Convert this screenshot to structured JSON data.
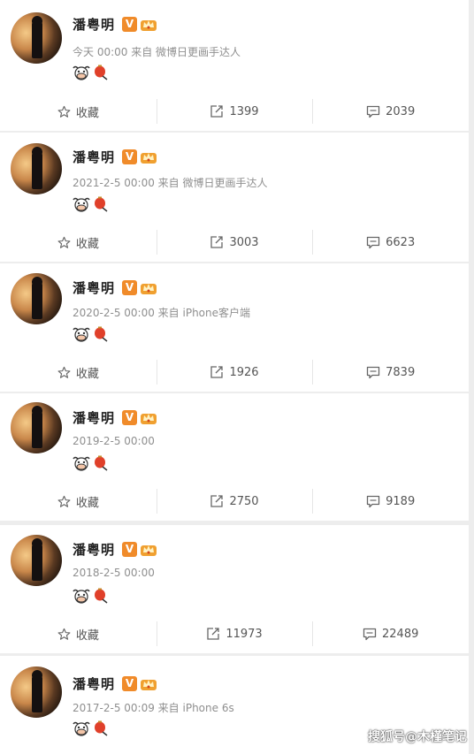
{
  "colors": {
    "vbadge": "#f08b2a",
    "meta": "#8f8f8f",
    "background": "#ededed"
  },
  "posts": [
    {
      "name": "潘粤明",
      "badge": "V",
      "meta": "今天 00:00 来自 微博日更画手达人",
      "favorite_label": "收藏",
      "repost_count": "1399",
      "comment_count": "2039"
    },
    {
      "name": "潘粤明",
      "badge": "V",
      "meta": "2021-2-5 00:00 来自 微博日更画手达人",
      "favorite_label": "收藏",
      "repost_count": "3003",
      "comment_count": "6623"
    },
    {
      "name": "潘粤明",
      "badge": "V",
      "meta": "2020-2-5 00:00 来自 iPhone客户端",
      "favorite_label": "收藏",
      "repost_count": "1926",
      "comment_count": "7839"
    },
    {
      "name": "潘粤明",
      "badge": "V",
      "meta": "2019-2-5 00:00",
      "favorite_label": "收藏",
      "repost_count": "2750",
      "comment_count": "9189"
    },
    {
      "name": "潘粤明",
      "badge": "V",
      "meta": "2018-2-5 00:00",
      "favorite_label": "收藏",
      "repost_count": "11973",
      "comment_count": "22489"
    },
    {
      "name": "潘粤明",
      "badge": "V",
      "meta": "2017-2-5 00:09 来自 iPhone 6s"
    }
  ],
  "icons": {
    "favorite": "star-icon",
    "repost": "repost-icon",
    "comment": "comment-icon",
    "emoji_1": "ox-face-emoji",
    "emoji_2": "lantern-emoji"
  },
  "watermark": "搜狐号@木槿笔记"
}
